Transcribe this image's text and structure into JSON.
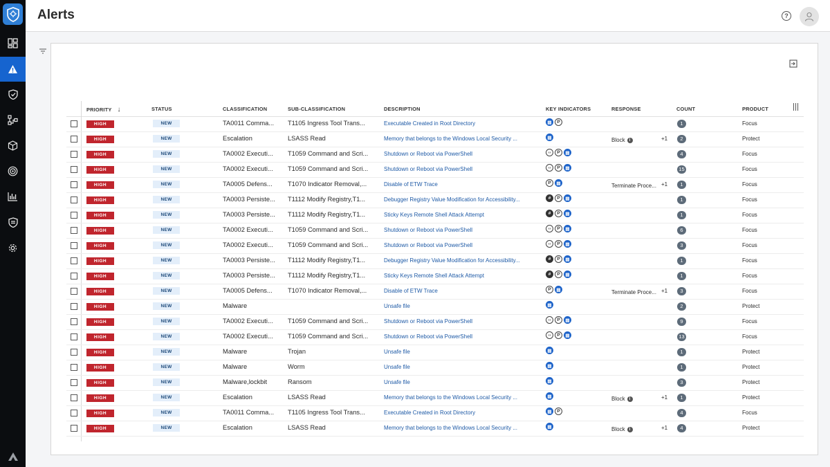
{
  "app": {
    "logo_icon": "shield-icon"
  },
  "nav": [
    {
      "icon": "dashboard-icon",
      "active": false
    },
    {
      "icon": "alerts-icon",
      "active": true
    },
    {
      "icon": "shield-check-icon",
      "active": false
    },
    {
      "icon": "network-icon",
      "active": false
    },
    {
      "icon": "cube-icon",
      "active": false
    },
    {
      "icon": "target-icon",
      "active": false
    },
    {
      "icon": "reports-icon",
      "active": false
    },
    {
      "icon": "shield-list-icon",
      "active": false
    },
    {
      "icon": "gear-icon",
      "active": false
    }
  ],
  "header": {
    "title": "Alerts",
    "help_icon": "help-icon",
    "avatar_icon": "user-icon"
  },
  "table": {
    "columns": {
      "priority": "PRIORITY",
      "status": "STATUS",
      "classification": "CLASSIFICATION",
      "sub_classification": "SUB-CLASSIFICATION",
      "description": "DESCRIPTION",
      "key_indicators": "KEY INDICATORS",
      "response": "RESPONSE",
      "count": "COUNT",
      "product": "PRODUCT"
    },
    "rows": [
      {
        "priority": "HIGH",
        "status": "NEW",
        "classification": "TA0011 Comma...",
        "sub": "T1105 Ingress Tool Trans...",
        "desc": "Executable Created in Root Directory",
        "ki": [
          "file",
          "p"
        ],
        "response": "",
        "plus": "",
        "count": "1",
        "product": "Focus"
      },
      {
        "priority": "HIGH",
        "status": "NEW",
        "classification": "Escalation",
        "sub": "LSASS Read",
        "desc": "Memory that belongs to the Windows Local Security ...",
        "ki": [
          "file"
        ],
        "response": "Block",
        "plus": "+1",
        "count": "2",
        "product": "Protect"
      },
      {
        "priority": "HIGH",
        "status": "NEW",
        "classification": "TA0002 Executi...",
        "sub": "T1059 Command and Scri...",
        "desc": "Shutdown or Reboot via PowerShell",
        "ki": [
          "code",
          "p",
          "file"
        ],
        "response": "",
        "plus": "",
        "count": "4",
        "product": "Focus"
      },
      {
        "priority": "HIGH",
        "status": "NEW",
        "classification": "TA0002 Executi...",
        "sub": "T1059 Command and Scri...",
        "desc": "Shutdown or Reboot via PowerShell",
        "ki": [
          "code",
          "p",
          "file"
        ],
        "response": "",
        "plus": "",
        "count": "15",
        "product": "Focus"
      },
      {
        "priority": "HIGH",
        "status": "NEW",
        "classification": "TA0005 Defens...",
        "sub": "T1070 Indicator Removal,...",
        "desc": "Disable of ETW Trace",
        "ki": [
          "p",
          "file"
        ],
        "response": "Terminate Proce...",
        "plus": "+1",
        "count": "1",
        "product": "Focus"
      },
      {
        "priority": "HIGH",
        "status": "NEW",
        "classification": "TA0003 Persiste...",
        "sub": "T1112 Modify Registry,T1...",
        "desc": "Debugger Registry Value Modification for Accessibility...",
        "ki": [
          "hash",
          "p",
          "file"
        ],
        "response": "",
        "plus": "",
        "count": "1",
        "product": "Focus"
      },
      {
        "priority": "HIGH",
        "status": "NEW",
        "classification": "TA0003 Persiste...",
        "sub": "T1112 Modify Registry,T1...",
        "desc": "Sticky Keys Remote Shell Attack Attempt",
        "ki": [
          "hash",
          "p",
          "file"
        ],
        "response": "",
        "plus": "",
        "count": "1",
        "product": "Focus"
      },
      {
        "priority": "HIGH",
        "status": "NEW",
        "classification": "TA0002 Executi...",
        "sub": "T1059 Command and Scri...",
        "desc": "Shutdown or Reboot via PowerShell",
        "ki": [
          "code",
          "p",
          "file"
        ],
        "response": "",
        "plus": "",
        "count": "6",
        "product": "Focus"
      },
      {
        "priority": "HIGH",
        "status": "NEW",
        "classification": "TA0002 Executi...",
        "sub": "T1059 Command and Scri...",
        "desc": "Shutdown or Reboot via PowerShell",
        "ki": [
          "code",
          "p",
          "file"
        ],
        "response": "",
        "plus": "",
        "count": "3",
        "product": "Focus"
      },
      {
        "priority": "HIGH",
        "status": "NEW",
        "classification": "TA0003 Persiste...",
        "sub": "T1112 Modify Registry,T1...",
        "desc": "Debugger Registry Value Modification for Accessibility...",
        "ki": [
          "hash",
          "p",
          "file"
        ],
        "response": "",
        "plus": "",
        "count": "1",
        "product": "Focus"
      },
      {
        "priority": "HIGH",
        "status": "NEW",
        "classification": "TA0003 Persiste...",
        "sub": "T1112 Modify Registry,T1...",
        "desc": "Sticky Keys Remote Shell Attack Attempt",
        "ki": [
          "hash",
          "p",
          "file"
        ],
        "response": "",
        "plus": "",
        "count": "1",
        "product": "Focus"
      },
      {
        "priority": "HIGH",
        "status": "NEW",
        "classification": "TA0005 Defens...",
        "sub": "T1070 Indicator Removal,...",
        "desc": "Disable of ETW Trace",
        "ki": [
          "p",
          "file"
        ],
        "response": "Terminate Proce...",
        "plus": "+1",
        "count": "3",
        "product": "Focus"
      },
      {
        "priority": "HIGH",
        "status": "NEW",
        "classification": "Malware",
        "sub": "",
        "desc": "Unsafe file",
        "ki": [
          "file"
        ],
        "response": "",
        "plus": "",
        "count": "2",
        "product": "Protect"
      },
      {
        "priority": "HIGH",
        "status": "NEW",
        "classification": "TA0002 Executi...",
        "sub": "T1059 Command and Scri...",
        "desc": "Shutdown or Reboot via PowerShell",
        "ki": [
          "code",
          "p",
          "file"
        ],
        "response": "",
        "plus": "",
        "count": "9",
        "product": "Focus"
      },
      {
        "priority": "HIGH",
        "status": "NEW",
        "classification": "TA0002 Executi...",
        "sub": "T1059 Command and Scri...",
        "desc": "Shutdown or Reboot via PowerShell",
        "ki": [
          "code",
          "p",
          "file"
        ],
        "response": "",
        "plus": "",
        "count": "13",
        "product": "Focus"
      },
      {
        "priority": "HIGH",
        "status": "NEW",
        "classification": "Malware",
        "sub": "Trojan",
        "desc": "Unsafe file",
        "ki": [
          "file"
        ],
        "response": "",
        "plus": "",
        "count": "1",
        "product": "Protect"
      },
      {
        "priority": "HIGH",
        "status": "NEW",
        "classification": "Malware",
        "sub": "Worm",
        "desc": "Unsafe file",
        "ki": [
          "file"
        ],
        "response": "",
        "plus": "",
        "count": "1",
        "product": "Protect"
      },
      {
        "priority": "HIGH",
        "status": "NEW",
        "classification": "Malware,lockbit",
        "sub": "Ransom",
        "desc": "Unsafe file",
        "ki": [
          "file"
        ],
        "response": "",
        "plus": "",
        "count": "3",
        "product": "Protect"
      },
      {
        "priority": "HIGH",
        "status": "NEW",
        "classification": "Escalation",
        "sub": "LSASS Read",
        "desc": "Memory that belongs to the Windows Local Security ...",
        "ki": [
          "file"
        ],
        "response": "Block",
        "plus": "+1",
        "count": "1",
        "product": "Protect"
      },
      {
        "priority": "HIGH",
        "status": "NEW",
        "classification": "TA0011 Comma...",
        "sub": "T1105 Ingress Tool Trans...",
        "desc": "Executable Created in Root Directory",
        "ki": [
          "file",
          "p"
        ],
        "response": "",
        "plus": "",
        "count": "4",
        "product": "Focus"
      },
      {
        "priority": "HIGH",
        "status": "NEW",
        "classification": "Escalation",
        "sub": "LSASS Read",
        "desc": "Memory that belongs to the Windows Local Security ...",
        "ki": [
          "file"
        ],
        "response": "Block",
        "plus": "+1",
        "count": "4",
        "product": "Protect"
      }
    ]
  },
  "colors": {
    "sidebar": "#0b0d10",
    "accent": "#1664cf",
    "priority_high": "#c0252d",
    "link": "#1e5aa6",
    "count_badge": "#5d6b79"
  }
}
